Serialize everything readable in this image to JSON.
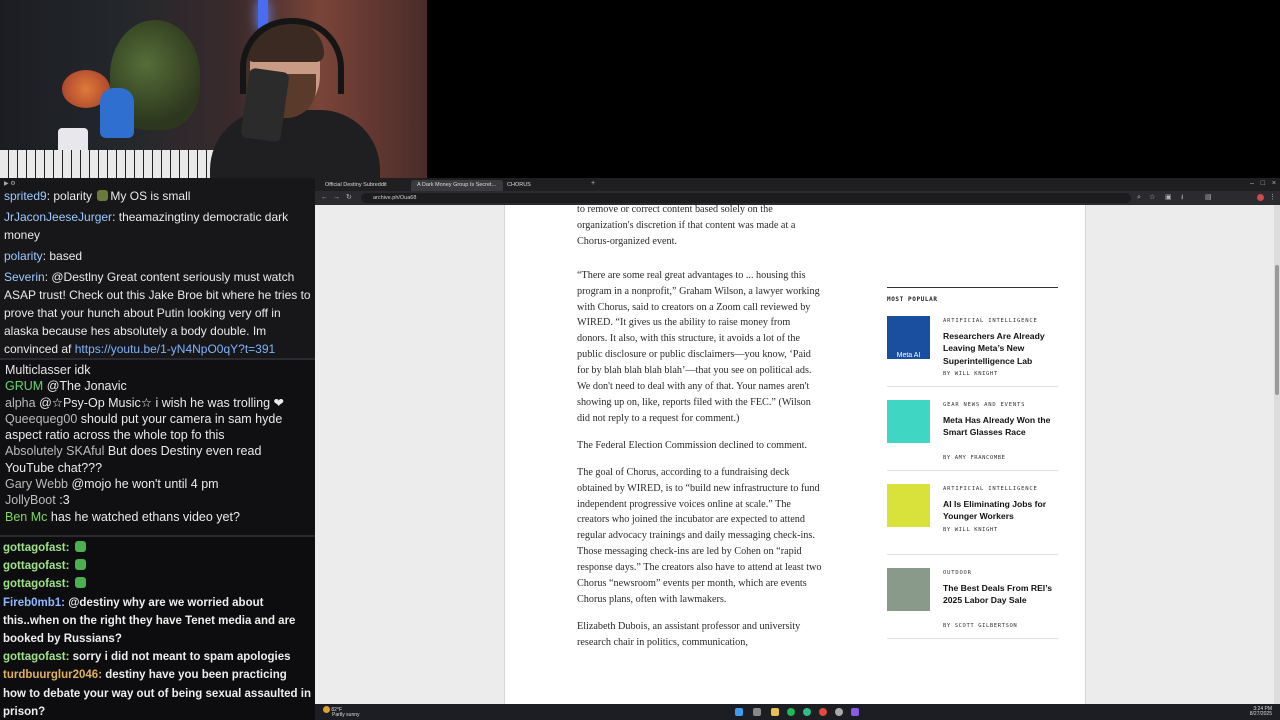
{
  "chat_top": [
    {
      "user": "sprited9",
      "text": "polarity",
      "emote_color": "#6a7a3a",
      "after": "My OS is small"
    },
    {
      "user": "JrJaconJeeseJurger",
      "text": "theamazingtiny democratic dark money"
    },
    {
      "user": "polarity",
      "text": "based"
    },
    {
      "user": "Severin",
      "text": "@Destlny Great content seriously must watch ASAP trust! Check out this Jake Broe bit where he tries to prove that your hunch about Putin looking very off in alaska because hes absolutely a body double. Im convinced af",
      "link": "https://youtu.be/1-yN4NpO0qY?t=391"
    }
  ],
  "chat_mid": [
    {
      "user": "Multiclasser",
      "text": "idk",
      "user_color": "#e6e6e6"
    },
    {
      "user": "GRUM",
      "text": "@The Jonavic",
      "user_color": "#63d66a"
    },
    {
      "user": "alpha",
      "text": "@☆Psy-Op Music☆ i wish he was trolling ❤",
      "user_color": "#bbbbbb"
    },
    {
      "user": "Queequeg00",
      "text": "should put your camera in sam hyde aspect ratio across the whole top fo this",
      "user_color": "#bbbbbb"
    },
    {
      "user": "Absolutely SKAful",
      "text": "But does Destiny even read YouTube chat???",
      "user_color": "#bbbbbb"
    },
    {
      "user": "Gary Webb",
      "text": "@mojo he won't until 4 pm",
      "user_color": "#bbbbbb"
    },
    {
      "user": "JollyBoot",
      "text": ":3",
      "user_color": "#bbbbbb"
    },
    {
      "user": "Ben Mc",
      "text": "has he watched ethans video yet?",
      "user_color": "#7ed957"
    }
  ],
  "chat_bottom": [
    {
      "user": "gottagofast:",
      "text": "",
      "user_color": "#9fe28a",
      "emote": "#4caf50"
    },
    {
      "user": "gottagofast:",
      "text": "",
      "user_color": "#9fe28a",
      "emote": "#4caf50"
    },
    {
      "user": "gottagofast:",
      "text": "",
      "user_color": "#9fe28a",
      "emote": "#4caf50"
    },
    {
      "user": "Fireb0mb1:",
      "text": "@destiny why are we worried about this..when on the right they have Tenet media and are booked by Russians?",
      "user_color": "#8fb8ff"
    },
    {
      "user": "gottagofast:",
      "text": "sorry i did not meant to spam apologies",
      "user_color": "#9fe28a"
    },
    {
      "user": "turdbuurglur2046:",
      "text": "destiny have you been practicing how to debate your way out of being sexual assaulted in prison?",
      "user_color": "#e0b05a"
    }
  ],
  "browser": {
    "tabs": [
      "Official Destiny Subreddit",
      "A Dark Money Group Is Secret...",
      "CHORUS"
    ],
    "address": "archive.ph/Oua68",
    "article": [
      "to remove or correct content based solely on the organization's discretion if that content was made at a Chorus-organized event.",
      "“There are some real great advantages to ... housing this program in a nonprofit,” Graham Wilson, a lawyer working with Chorus, said to creators on a Zoom call reviewed by WIRED. “It gives us the ability to raise money from donors. It also, with this structure, it avoids a lot of the public disclosure or public disclaimers—you know, ‘Paid for by blah blah blah blah’—that you see on political ads. We don't need to deal with any of that. Your names aren't showing up on, like, reports filed with the FEC.” (Wilson did not reply to a request for comment.)",
      "The Federal Election Commission declined to comment.",
      "The goal of Chorus, according to a fundraising deck obtained by WIRED, is to “build new infrastructure to fund independent progressive voices online at scale.” The creators who joined the incubator are expected to attend regular advocacy trainings and daily messaging check-ins. Those messaging check-ins are led by Cohen on “rapid response days.” The creators also have to attend at least two Chorus “newsroom” events per month, which are events Chorus plans, often with lawmakers.",
      "Elizabeth Dubois, an assistant professor and university research chair in politics, communication,"
    ],
    "most_popular_label": "MOST POPULAR",
    "popular": [
      {
        "category": "ARTIFICIAL INTELLIGENCE",
        "headline": "Researchers Are Already Leaving Meta’s New Superintelligence Lab",
        "byline": "BY WILL KNIGHT",
        "thumb_color": "#1a4fa0",
        "thumb_text": "Meta AI"
      },
      {
        "category": "GEAR NEWS AND EVENTS",
        "headline": "Meta Has Already Won the Smart Glasses Race",
        "byline": "BY AMY FRANCOMBE",
        "thumb_color": "#3fd6c4",
        "thumb_text": ""
      },
      {
        "category": "ARTIFICIAL INTELLIGENCE",
        "headline": "AI Is Eliminating Jobs for Younger Workers",
        "byline": "BY WILL KNIGHT",
        "thumb_color": "#d8e23a",
        "thumb_text": ""
      },
      {
        "category": "OUTDOOR",
        "headline": "The Best Deals From REI’s 2025 Labor Day Sale",
        "byline": "BY SCOTT GILBERTSON",
        "thumb_color": "#8a9a8a",
        "thumb_text": ""
      }
    ]
  },
  "taskbar": {
    "weather_temp": "82°F",
    "weather_text": "Partly sunny",
    "time": "3:24 PM",
    "date": "8/27/2025"
  }
}
